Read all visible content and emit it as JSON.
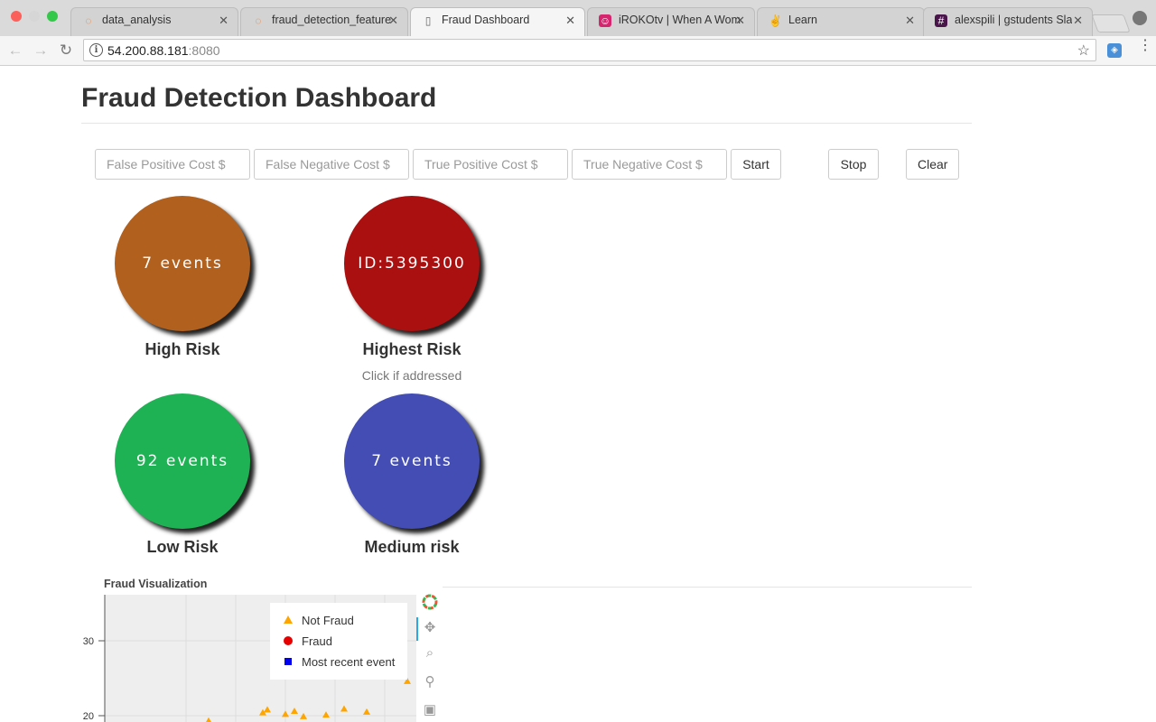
{
  "browser": {
    "tabs": [
      {
        "label": "data_analysis",
        "icon": "jupyter-icon"
      },
      {
        "label": "fraud_detection_feature",
        "icon": "jupyter-icon"
      },
      {
        "label": "Fraud Dashboard",
        "icon": "page-icon"
      },
      {
        "label": "iROKOtv | When A Wom",
        "icon": "irokotv-icon"
      },
      {
        "label": "Learn",
        "icon": "learn-icon"
      },
      {
        "label": "alexspili | gstudents Sla",
        "icon": "slack-icon"
      }
    ],
    "url_host": "54.200.88.181",
    "url_port": ":8080"
  },
  "page": {
    "title": "Fraud Detection Dashboard"
  },
  "controls": {
    "fp_placeholder": "False Positive Cost $",
    "fn_placeholder": "False Negative Cost $",
    "tp_placeholder": "True Positive Cost $",
    "tn_placeholder": "True Negative Cost $",
    "start_label": "Start",
    "stop_label": "Stop",
    "clear_label": "Clear"
  },
  "risk": {
    "high": {
      "value": "7 events",
      "label": "High Risk",
      "color": "#b1601e"
    },
    "highest": {
      "value": "ID:5395300",
      "label": "Highest Risk",
      "hint": "Click if addressed",
      "color": "#ab1010"
    },
    "low": {
      "value": "92 events",
      "label": "Low Risk",
      "color": "#1fb254"
    },
    "medium": {
      "value": "7 events",
      "label": "Medium risk",
      "color": "#434db3"
    }
  },
  "visualization": {
    "title": "Fraud Visualization"
  },
  "chart_data": {
    "type": "scatter",
    "title": "Fraud Visualization",
    "yticks": [
      30,
      20
    ],
    "legend": [
      {
        "label": "Not Fraud",
        "marker": "triangle",
        "color": "#ffa500"
      },
      {
        "label": "Fraud",
        "marker": "circle",
        "color": "#e60000"
      },
      {
        "label": "Most recent event",
        "marker": "square",
        "color": "#0000ee"
      }
    ],
    "legend_position": "top-right",
    "grid": true,
    "series": [
      {
        "name": "Not Fraud",
        "points": [
          [
            25.6,
            19.3
          ],
          [
            26.8,
            20.4
          ],
          [
            26.9,
            20.8
          ],
          [
            27.3,
            20.2
          ],
          [
            27.5,
            20.6
          ],
          [
            27.7,
            19.9
          ],
          [
            28.2,
            20.1
          ],
          [
            28.6,
            20.9
          ],
          [
            29.1,
            20.5
          ],
          [
            30.0,
            24.6
          ]
        ]
      }
    ]
  }
}
